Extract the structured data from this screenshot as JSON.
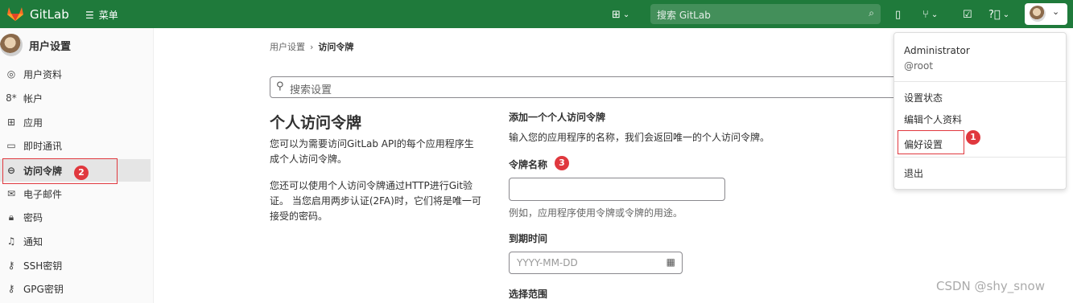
{
  "topbar": {
    "brand": "GitLab",
    "menu_label": "菜单",
    "search_placeholder": "搜索 GitLab",
    "icons": [
      "plus-square-icon",
      "search-icon",
      "todo-icon",
      "merge-request-icon",
      "issues-check-icon",
      "help-icon",
      "avatar"
    ]
  },
  "sidebar": {
    "title": "用户设置",
    "items": [
      {
        "label": "用户资料",
        "icon": "user-icon"
      },
      {
        "label": "帐户",
        "icon": "account-icon"
      },
      {
        "label": "应用",
        "icon": "apps-icon"
      },
      {
        "label": "即时通讯",
        "icon": "chat-icon"
      },
      {
        "label": "访问令牌",
        "icon": "token-icon",
        "active": true
      },
      {
        "label": "电子邮件",
        "icon": "mail-icon"
      },
      {
        "label": "密码",
        "icon": "lock-icon"
      },
      {
        "label": "通知",
        "icon": "bell-icon"
      },
      {
        "label": "SSH密钥",
        "icon": "key-icon"
      },
      {
        "label": "GPG密钥",
        "icon": "key-icon"
      }
    ]
  },
  "breadcrumb": {
    "parent": "用户设置",
    "current": "访问令牌"
  },
  "search_settings_placeholder": "搜索设置",
  "left": {
    "title": "个人访问令牌",
    "desc1": "您可以为需要访问GitLab API的每个应用程序生成个人访问令牌。",
    "desc2": "您还可以使用个人访问令牌通过HTTP进行Git验证。 当您启用两步认证(2FA)时，它们将是唯一可接受的密码。"
  },
  "form": {
    "title": "添加一个个人访问令牌",
    "subtitle": "输入您的应用程序的名称，我们会返回唯一的个人访问令牌。",
    "token_name_label": "令牌名称",
    "token_name_value": "",
    "token_name_hint": "例如，应用程序使用令牌或令牌的用途。",
    "expiry_label": "到期时间",
    "expiry_placeholder": "YYYY-MM-DD",
    "scopes_label": "选择范围"
  },
  "dropdown": {
    "name": "Administrator",
    "username": "@root",
    "items": [
      "设置状态",
      "编辑个人资料",
      "偏好设置",
      "退出"
    ]
  },
  "annotations": [
    "1",
    "2",
    "3"
  ],
  "watermark": "CSDN @shy_snow",
  "colors": {
    "topbar": "#1f7a3b",
    "annotation": "#e0383e"
  }
}
